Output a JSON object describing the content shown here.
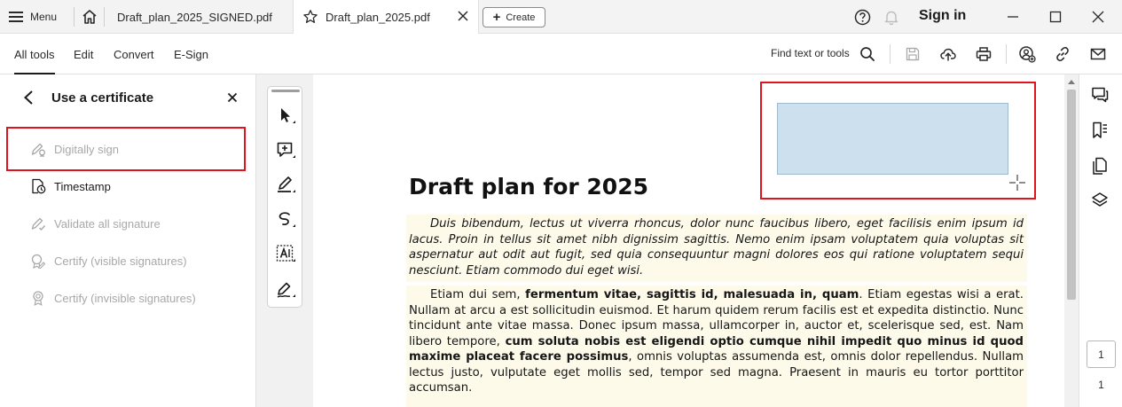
{
  "titlebar": {
    "menu_label": "Menu",
    "tabs": [
      {
        "label": "Draft_plan_2025_SIGNED.pdf",
        "active": false
      },
      {
        "label": "Draft_plan_2025.pdf",
        "active": true
      }
    ],
    "create_label": "Create",
    "sign_in_label": "Sign in"
  },
  "toolbar": {
    "nav": [
      {
        "label": "All tools",
        "active": true
      },
      {
        "label": "Edit",
        "active": false
      },
      {
        "label": "Convert",
        "active": false
      },
      {
        "label": "E-Sign",
        "active": false
      }
    ],
    "find_label": "Find text or tools"
  },
  "left_panel": {
    "title": "Use a certificate",
    "items": [
      {
        "label": "Digitally sign",
        "icon": "digital-sign-icon",
        "enabled": false
      },
      {
        "label": "Timestamp",
        "icon": "timestamp-icon",
        "enabled": true
      },
      {
        "label": "Validate all signature",
        "icon": "validate-signature-icon",
        "enabled": false
      },
      {
        "label": "Certify (visible signatures)",
        "icon": "certify-visible-icon",
        "enabled": false
      },
      {
        "label": "Certify (invisible signatures)",
        "icon": "certify-invisible-icon",
        "enabled": false
      }
    ]
  },
  "document": {
    "title": "Draft plan for 2025",
    "paragraph1": "Duis bibendum, lectus ut viverra rhoncus, dolor nunc faucibus libero, eget facilisis enim ipsum id lacus. Proin in tellus sit amet nibh dignissim sagittis. Nemo enim ipsam voluptatem quia voluptas sit aspernatur aut odit aut fugit, sed quia consequuntur magni dolores eos qui ratione voluptatem sequi nesciunt. Etiam commodo dui eget wisi.",
    "paragraph2": {
      "p1": "Etiam dui sem, ",
      "b1": "fermentum vitae, sagittis id, malesuada in, quam",
      "p2": ". Etiam egestas wisi a erat. Nullam at arcu a est sollicitudin euismod. Et harum quidem rerum facilis est et expedita distinctio. Nunc tincidunt ante vitae massa. Donec ipsum massa, ullamcorper in, auctor et, scelerisque sed, est. Nam libero tempore, ",
      "b2": "cum soluta nobis est eligendi optio cumque nihil impedit quo minus id quod maxime placeat facere possimus",
      "p3": ", omnis voluptas assumenda est, omnis dolor repellendus. Nullam lectus justo, vulputate eget mollis sed, tempor sed magna. Praesent in mauris eu tortor porttitor accumsan."
    }
  },
  "page_nav": {
    "current": "1",
    "total": "1"
  },
  "colors": {
    "highlight_box": "#e0141e",
    "signature_field": "#cde0ed",
    "paragraph_bg": "#fdfaea",
    "disabled_text": "#a8a8a8"
  }
}
